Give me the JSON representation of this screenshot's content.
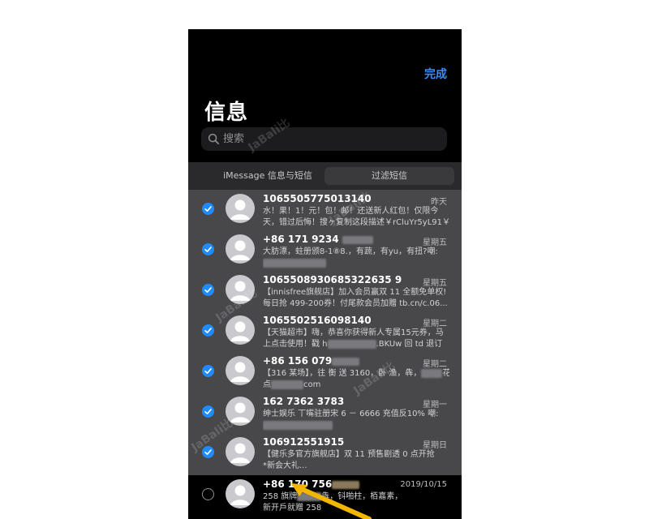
{
  "header": {
    "done_label": "完成",
    "title": "信息"
  },
  "search": {
    "placeholder": "搜索"
  },
  "filter": {
    "tab_1": "iMessage 信息与短信",
    "tab_2": "过滤短信"
  },
  "messages": [
    {
      "sender": "1065505775013140",
      "time": "昨天",
      "line1": "水！果！1！元！包！邮！还送新人红包！仅限今",
      "line2": "天，错过后悔！搜ヶ复制这段描述￥rCluYr5yL91￥...",
      "selected": true
    },
    {
      "sender": "+86 171 9234",
      "time": "星期五",
      "line1": "大肪漂，蛀册颁8-1⑧8.，有蔬，有yu，有扭?嘲:",
      "line2": "",
      "selected": true
    },
    {
      "sender": "1065508930685322635 9",
      "time": "星期五",
      "line1": "【innisfree旗舰店】加入会员赢双 11 全额免单权!",
      "line2": "每日抢 499-200券！付尾款会员加赠  tb.cn/c.06...",
      "selected": true
    },
    {
      "sender": "1065502516098140",
      "time": "星期二",
      "line1": "【天猫超市】嗨，恭喜你获得新人专属15元券，马",
      "line2": "上点击使用！戳 h",
      "line2_tail": ".BKUw 回 td 退订",
      "selected": true
    },
    {
      "sender": "+86 156 079",
      "time": "星期二",
      "line1": "【316 某场】，往 衡 送 3160，卧 渔，犇，",
      "line1_tail": "花.",
      "line2": "点",
      "line2_tail": "com",
      "selected": true
    },
    {
      "sender": "162 7362 3783",
      "time": "星期一",
      "line1": "绅士娱乐 丅嘴驻册宋 6 － 6666 充值反10% 嘲:",
      "line2": "",
      "selected": true
    },
    {
      "sender": "106912551915",
      "time": "星期日",
      "line1": "【健乐多官方旗舰店】双 11 预售剧透 0 点开抢",
      "line2": "*新会大礼...",
      "selected": true
    },
    {
      "sender": "+86 170 756",
      "time": "2019/10/15",
      "line1": "258 旗牌",
      "line1_tail": "犇，钭啪柱，栢嘉素，",
      "line2": "新开戶就赠 258",
      "selected": false
    }
  ],
  "watermark": "JaBali比",
  "colors": {
    "accent": "#1f8bff",
    "done_text": "#3b8bff",
    "arrow": "#f2b500"
  }
}
